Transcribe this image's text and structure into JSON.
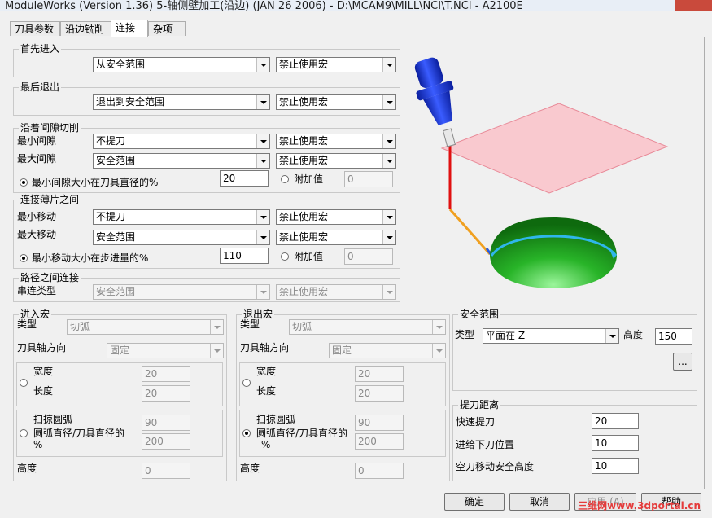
{
  "window": {
    "title": "ModuleWorks (Version 1.36) 5-轴侧壁加工(沿边) (JAN 26 2006) - D:\\MCAM9\\MILL\\NCI\\T.NCI - A2100E"
  },
  "tabs": [
    "刀具参数",
    "沿边铣削",
    "连接",
    "杂项"
  ],
  "first_entry": {
    "label": "首先进入",
    "mode": "从安全范围",
    "macro": "禁止使用宏"
  },
  "last_exit": {
    "label": "最后退出",
    "mode": "退出到安全范围",
    "macro": "禁止使用宏"
  },
  "gap_cut": {
    "label": "沿着间隙切削",
    "min_label": "最小间隙",
    "min_mode": "不提刀",
    "min_macro": "禁止使用宏",
    "max_label": "最大间隙",
    "max_mode": "安全范围",
    "max_macro": "禁止使用宏",
    "radio_pct": "最小间隙大小在刀具直径的%",
    "pct_value": "20",
    "radio_add": "附加值",
    "add_value": "0"
  },
  "between_slices": {
    "label": "连接薄片之间",
    "min_label": "最小移动",
    "min_mode": "不提刀",
    "min_macro": "禁止使用宏",
    "max_label": "最大移动",
    "max_mode": "安全范围",
    "max_macro": "禁止使用宏",
    "radio_pct": "最小移动大小在步进量的%",
    "pct_value": "110",
    "radio_add": "附加值",
    "add_value": "0"
  },
  "between_paths": {
    "label": "路径之间连接",
    "type_label": "串连类型",
    "mode": "安全范围",
    "macro": "禁止使用宏"
  },
  "entry_macro": {
    "label": "进入宏",
    "type_label": "类型",
    "type_value": "切弧",
    "axis_label": "刀具轴方向",
    "axis_value": "固定",
    "width_label": "宽度",
    "width_value": "20",
    "length_label": "长度",
    "length_value": "20",
    "sweep_label": "扫掠圆弧",
    "sweep_value": "90",
    "arc_label": "圆弧直径/刀具直径的",
    "arc_pct": "%",
    "arc_value": "200",
    "height_label": "高度",
    "height_value": "0"
  },
  "exit_macro": {
    "label": "退出宏",
    "type_label": "类型",
    "type_value": "切弧",
    "axis_label": "刀具轴方向",
    "axis_value": "固定",
    "width_label": "宽度",
    "width_value": "20",
    "length_label": "长度",
    "length_value": "20",
    "sweep_label": "扫掠圆弧",
    "sweep_value": "90",
    "arc_label": "圆弧直径/刀具直径的",
    "arc_pct": "%",
    "arc_value": "200",
    "height_label": "高度",
    "height_value": "0"
  },
  "safety": {
    "label": "安全范围",
    "type_label": "类型",
    "type_value": "平面在 Z",
    "height_label": "高度",
    "height_value": "150",
    "browse": "..."
  },
  "retract": {
    "label": "提刀距离",
    "rapid_label": "快速提刀",
    "rapid_value": "20",
    "feed_label": "进给下刀位置",
    "feed_value": "10",
    "safe_label": "空刀移动安全高度",
    "safe_value": "10"
  },
  "buttons": {
    "ok": "确定",
    "cancel": "取消",
    "apply": "应用 (A)",
    "help": "帮助"
  },
  "watermark": "三维网www.3dportal.cn",
  "colors": {
    "plane": "#f9c9cf",
    "tool": "#1f3ddb",
    "dome": "#1e8f1e",
    "arc": "#2fb6ea"
  }
}
